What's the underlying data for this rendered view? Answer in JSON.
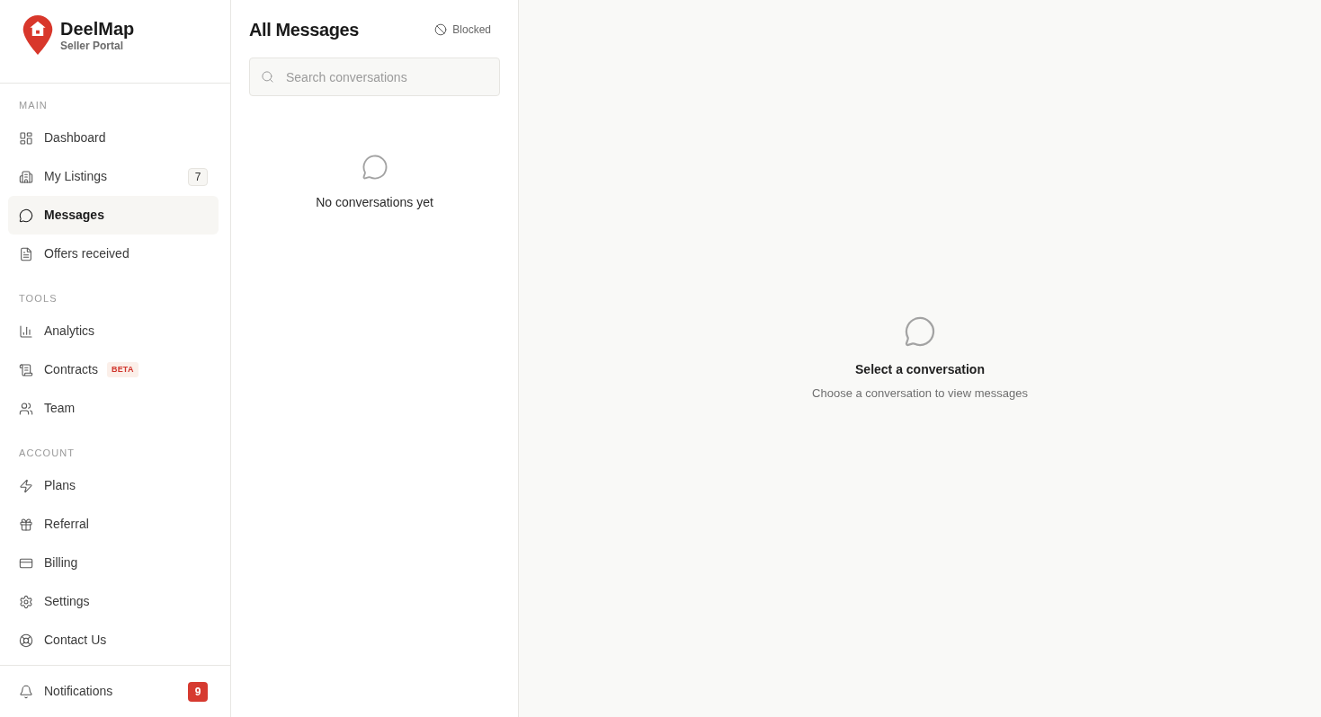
{
  "brand": {
    "name": "DeelMap",
    "subtitle": "Seller Portal"
  },
  "sidebar": {
    "sections": [
      {
        "label": "MAIN",
        "items": [
          {
            "label": "Dashboard",
            "selected": false
          },
          {
            "label": "My Listings",
            "selected": false,
            "badge": {
              "kind": "count",
              "text": "7"
            }
          },
          {
            "label": "Messages",
            "selected": true
          },
          {
            "label": "Offers received",
            "selected": false
          }
        ]
      },
      {
        "label": "TOOLS",
        "items": [
          {
            "label": "Analytics",
            "selected": false
          },
          {
            "label": "Contracts",
            "selected": false,
            "badge": {
              "kind": "tag",
              "text": "BETA"
            }
          },
          {
            "label": "Team",
            "selected": false
          }
        ]
      },
      {
        "label": "ACCOUNT",
        "items": [
          {
            "label": "Plans",
            "selected": false
          },
          {
            "label": "Referral",
            "selected": false
          },
          {
            "label": "Billing",
            "selected": false
          },
          {
            "label": "Settings",
            "selected": false
          },
          {
            "label": "Contact Us",
            "selected": false
          }
        ]
      }
    ],
    "footer": {
      "label": "Notifications",
      "selected": false,
      "badge": {
        "kind": "alert",
        "text": "9"
      }
    }
  },
  "conversation_list": {
    "title": "All Messages",
    "blocked_button": "Blocked",
    "search": {
      "placeholder": "Search conversations"
    },
    "empty_state": "No conversations yet"
  },
  "conversation_pane": {
    "title": "Select a conversation",
    "subtitle": "Choose a conversation to view messages"
  }
}
